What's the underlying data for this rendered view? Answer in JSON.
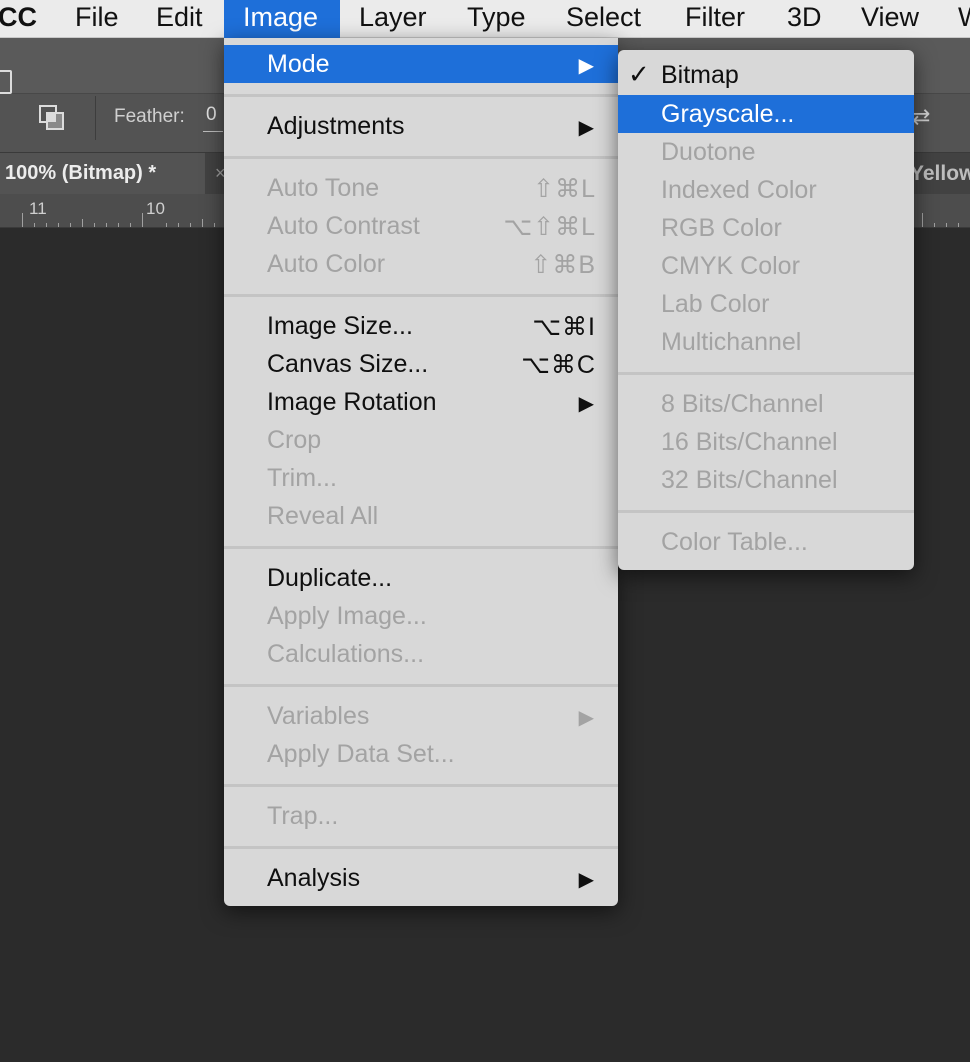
{
  "menubar": {
    "items": [
      "CC",
      "File",
      "Edit",
      "Image",
      "Layer",
      "Type",
      "Select",
      "Filter",
      "3D",
      "View",
      "W"
    ],
    "active": "Image"
  },
  "options_bar": {
    "feather_label": "Feather:",
    "feather_value": "0"
  },
  "document": {
    "tab_title": "100% (Bitmap) *",
    "tab_close": "×",
    "next_tab_title": "Yellow"
  },
  "ruler": {
    "labels": [
      "11",
      "10"
    ]
  },
  "image_menu": {
    "items": [
      {
        "label": "Mode",
        "shortcut": "",
        "submenu": true,
        "enabled": true,
        "highlighted": true
      },
      {
        "separator": true
      },
      {
        "label": "Adjustments",
        "shortcut": "",
        "submenu": true,
        "enabled": true
      },
      {
        "separator": true
      },
      {
        "label": "Auto Tone",
        "shortcut": "⇧⌘L",
        "enabled": false
      },
      {
        "label": "Auto Contrast",
        "shortcut": "⌥⇧⌘L",
        "enabled": false
      },
      {
        "label": "Auto Color",
        "shortcut": "⇧⌘B",
        "enabled": false
      },
      {
        "separator": true
      },
      {
        "label": "Image Size...",
        "shortcut": "⌥⌘I",
        "enabled": true
      },
      {
        "label": "Canvas Size...",
        "shortcut": "⌥⌘C",
        "enabled": true
      },
      {
        "label": "Image Rotation",
        "shortcut": "",
        "submenu": true,
        "enabled": true
      },
      {
        "label": "Crop",
        "shortcut": "",
        "enabled": false
      },
      {
        "label": "Trim...",
        "shortcut": "",
        "enabled": false
      },
      {
        "label": "Reveal All",
        "shortcut": "",
        "enabled": false
      },
      {
        "separator": true
      },
      {
        "label": "Duplicate...",
        "shortcut": "",
        "enabled": true
      },
      {
        "label": "Apply Image...",
        "shortcut": "",
        "enabled": false
      },
      {
        "label": "Calculations...",
        "shortcut": "",
        "enabled": false
      },
      {
        "separator": true
      },
      {
        "label": "Variables",
        "shortcut": "",
        "submenu": true,
        "enabled": false
      },
      {
        "label": "Apply Data Set...",
        "shortcut": "",
        "enabled": false
      },
      {
        "separator": true
      },
      {
        "label": "Trap...",
        "shortcut": "",
        "enabled": false
      },
      {
        "separator": true
      },
      {
        "label": "Analysis",
        "shortcut": "",
        "submenu": true,
        "enabled": true
      }
    ]
  },
  "mode_submenu": {
    "items": [
      {
        "label": "Bitmap",
        "checked": true,
        "enabled": true
      },
      {
        "label": "Grayscale...",
        "enabled": true,
        "highlighted": true
      },
      {
        "label": "Duotone",
        "enabled": false
      },
      {
        "label": "Indexed Color",
        "enabled": false
      },
      {
        "label": "RGB Color",
        "enabled": false
      },
      {
        "label": "CMYK Color",
        "enabled": false
      },
      {
        "label": "Lab Color",
        "enabled": false
      },
      {
        "label": "Multichannel",
        "enabled": false
      },
      {
        "separator": true
      },
      {
        "label": "8 Bits/Channel",
        "enabled": false
      },
      {
        "label": "16 Bits/Channel",
        "enabled": false
      },
      {
        "label": "32 Bits/Channel",
        "enabled": false
      },
      {
        "separator": true
      },
      {
        "label": "Color Table...",
        "enabled": false
      }
    ]
  },
  "colors": {
    "menu_highlight": "#1e6fd9",
    "menu_bg": "#d8d8d8",
    "canvas_bg": "#2b2b2b"
  }
}
